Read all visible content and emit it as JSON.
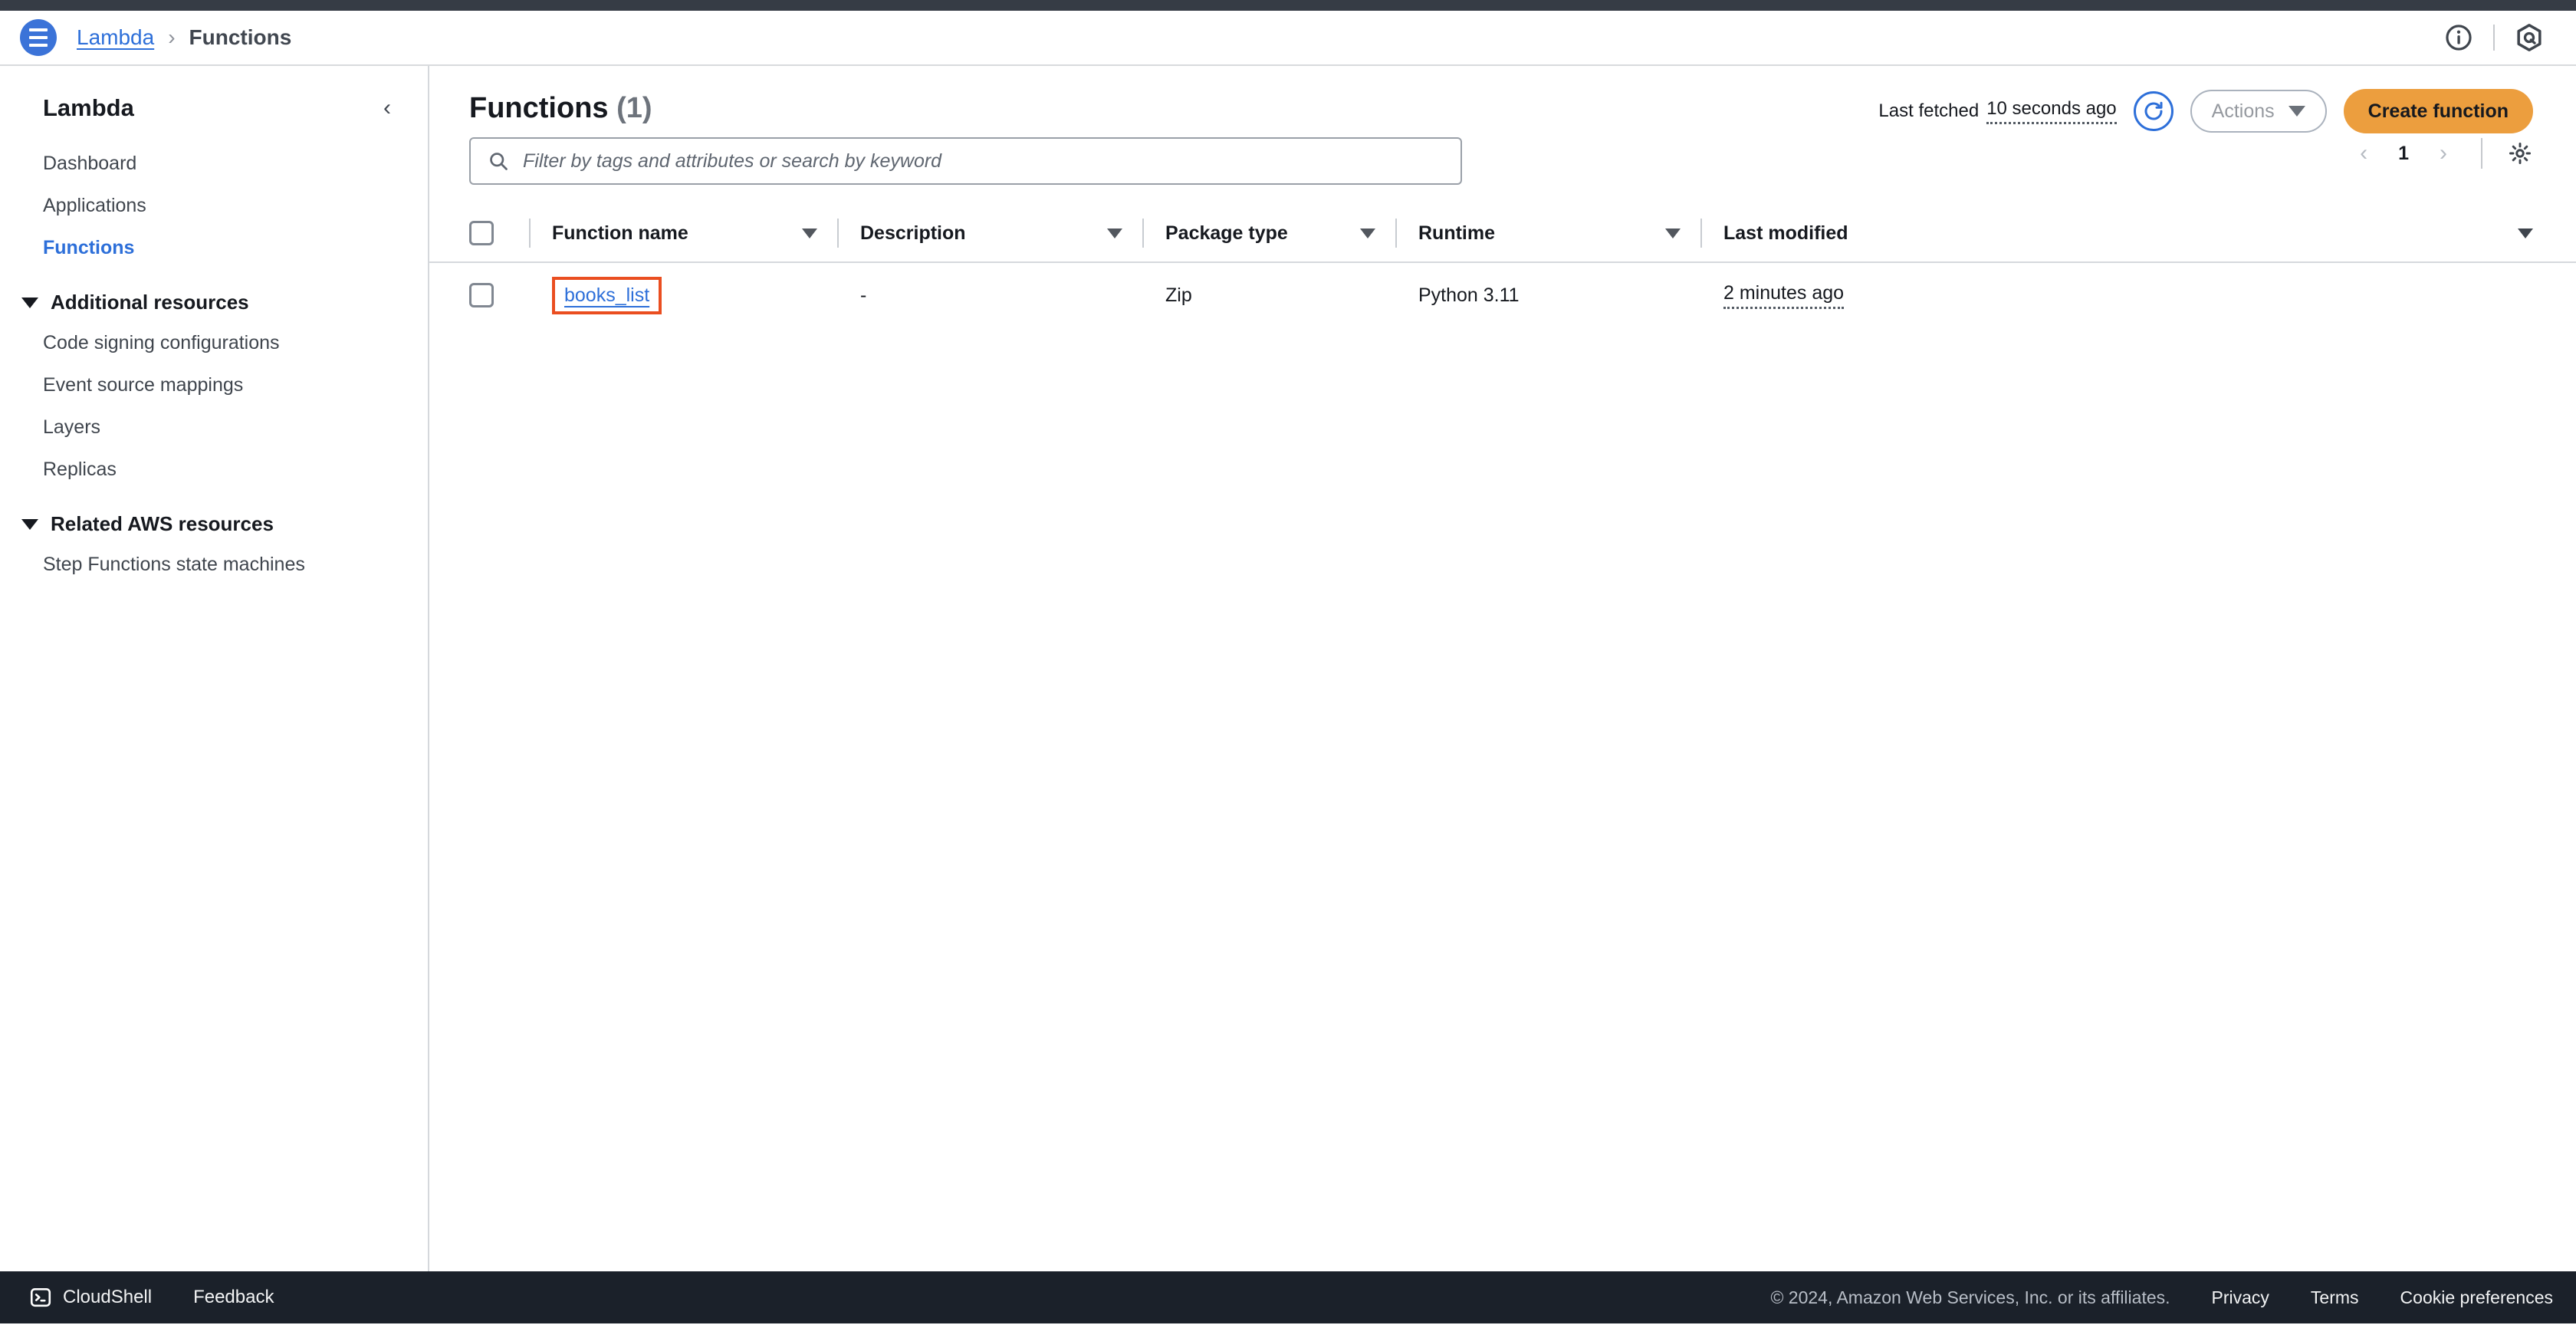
{
  "header": {
    "menu_icon": "hamburger-menu-icon",
    "breadcrumb_root": "Lambda",
    "breadcrumb_separator": "›",
    "breadcrumb_current": "Functions",
    "info_icon": "info-circle-icon",
    "assistant_icon": "amazon-q-icon"
  },
  "sidebar": {
    "title": "Lambda",
    "collapse_icon": "chevron-left-icon",
    "items": [
      {
        "label": "Dashboard",
        "active": false
      },
      {
        "label": "Applications",
        "active": false
      },
      {
        "label": "Functions",
        "active": true
      }
    ],
    "sections": [
      {
        "label": "Additional resources",
        "toggle_icon": "triangle-down-icon",
        "items": [
          {
            "label": "Code signing configurations"
          },
          {
            "label": "Event source mappings"
          },
          {
            "label": "Layers"
          },
          {
            "label": "Replicas"
          }
        ]
      },
      {
        "label": "Related AWS resources",
        "toggle_icon": "triangle-down-icon",
        "items": [
          {
            "label": "Step Functions state machines"
          }
        ]
      }
    ]
  },
  "main": {
    "page_title": "Functions",
    "page_count": "(1)",
    "last_fetched_label": "Last fetched",
    "last_fetched_value": "10 seconds ago",
    "refresh_icon": "refresh-icon",
    "actions_label": "Actions",
    "actions_caret_icon": "caret-down-icon",
    "create_label": "Create function",
    "search": {
      "placeholder": "Filter by tags and attributes or search by keyword",
      "value": "",
      "icon": "search-icon"
    },
    "pagination": {
      "prev_icon": "chevron-left-icon",
      "page": "1",
      "next_icon": "chevron-right-icon",
      "settings_icon": "gear-icon"
    }
  },
  "table": {
    "columns": [
      {
        "label": "Function name",
        "sortable": true
      },
      {
        "label": "Description",
        "sortable": true
      },
      {
        "label": "Package type",
        "sortable": true
      },
      {
        "label": "Runtime",
        "sortable": true
      },
      {
        "label": "Last modified",
        "sortable": false
      }
    ],
    "rows": [
      {
        "function_name": "books_list",
        "description": "-",
        "package_type": "Zip",
        "runtime": "Python 3.11",
        "last_modified": "2 minutes ago",
        "highlighted": true
      }
    ]
  },
  "footer": {
    "cloudshell_label": "CloudShell",
    "cloudshell_icon": "terminal-icon",
    "feedback_label": "Feedback",
    "copyright": "© 2024, Amazon Web Services, Inc. or its affiliates.",
    "links": [
      "Privacy",
      "Terms",
      "Cookie preferences"
    ]
  },
  "colors": {
    "accent_blue": "#2d6fd9",
    "create_orange": "#ec9e3e",
    "highlight_red": "#ea4e20",
    "footer_dark": "#1b212a",
    "topstrip_dark": "#363c45"
  }
}
